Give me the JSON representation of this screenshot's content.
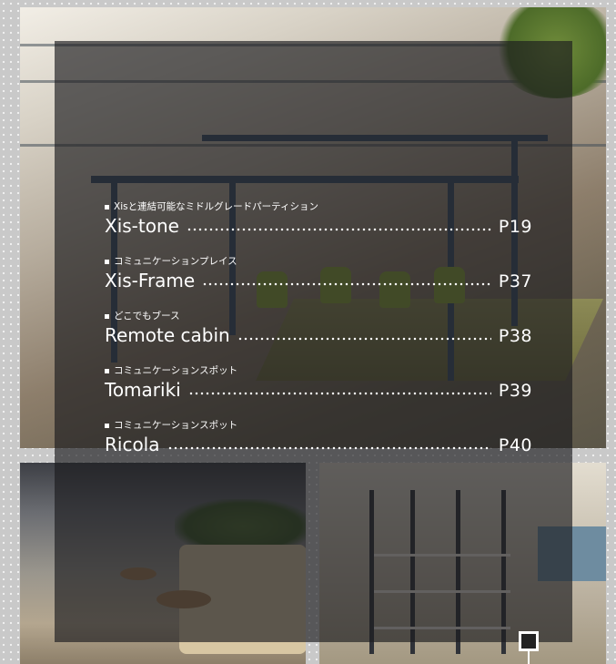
{
  "toc": {
    "entries": [
      {
        "category": "Xisと連結可能なミドルグレードパーティション",
        "title": "Xis-tone",
        "page": "P19"
      },
      {
        "category": "コミュニケーションプレイス",
        "title": "Xis-Frame",
        "page": "P37"
      },
      {
        "category": "どこでもブース",
        "title": "Remote cabin",
        "page": "P38"
      },
      {
        "category": "コミュニケーションスポット",
        "title": "Tomariki",
        "page": "P39"
      },
      {
        "category": "コミュニケーションスポット",
        "title": "Ricola",
        "page": "P40"
      }
    ]
  },
  "colors": {
    "overlay": "#1c1c1e",
    "text": "#ffffff",
    "background": "#c9c9c9"
  }
}
